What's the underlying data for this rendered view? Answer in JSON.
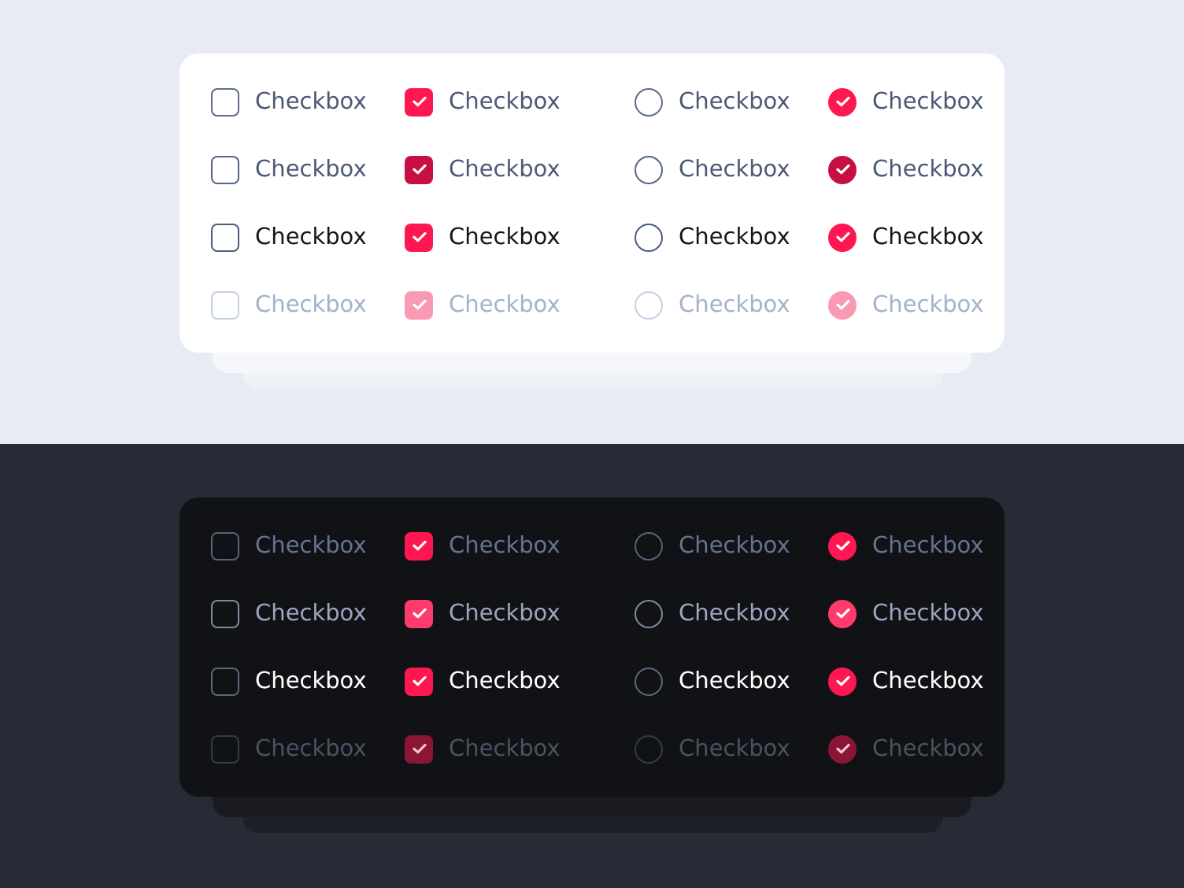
{
  "panels": [
    {
      "kind": "light",
      "rows": [
        {
          "kind": "default",
          "items": [
            {
              "kind": "square",
              "checked": false,
              "label": "Checkbox"
            },
            {
              "kind": "square",
              "checked": true,
              "label": "Checkbox"
            },
            {
              "kind": "round",
              "checked": false,
              "label": "Checkbox"
            },
            {
              "kind": "round",
              "checked": true,
              "label": "Checkbox"
            }
          ]
        },
        {
          "kind": "hover",
          "items": [
            {
              "kind": "square",
              "checked": false,
              "label": "Checkbox"
            },
            {
              "kind": "square",
              "checked": true,
              "label": "Checkbox"
            },
            {
              "kind": "round",
              "checked": false,
              "label": "Checkbox"
            },
            {
              "kind": "round",
              "checked": true,
              "label": "Checkbox"
            }
          ]
        },
        {
          "kind": "focus",
          "items": [
            {
              "kind": "square",
              "checked": false,
              "label": "Checkbox"
            },
            {
              "kind": "square",
              "checked": true,
              "label": "Checkbox"
            },
            {
              "kind": "round",
              "checked": false,
              "label": "Checkbox"
            },
            {
              "kind": "round",
              "checked": true,
              "label": "Checkbox"
            }
          ]
        },
        {
          "kind": "disabled",
          "items": [
            {
              "kind": "square",
              "checked": false,
              "label": "Checkbox"
            },
            {
              "kind": "square",
              "checked": true,
              "label": "Checkbox"
            },
            {
              "kind": "round",
              "checked": false,
              "label": "Checkbox"
            },
            {
              "kind": "round",
              "checked": true,
              "label": "Checkbox"
            }
          ]
        }
      ]
    },
    {
      "kind": "dark",
      "rows": [
        {
          "kind": "default",
          "items": [
            {
              "kind": "square",
              "checked": false,
              "label": "Checkbox"
            },
            {
              "kind": "square",
              "checked": true,
              "label": "Checkbox"
            },
            {
              "kind": "round",
              "checked": false,
              "label": "Checkbox"
            },
            {
              "kind": "round",
              "checked": true,
              "label": "Checkbox"
            }
          ]
        },
        {
          "kind": "hover",
          "items": [
            {
              "kind": "square",
              "checked": false,
              "label": "Checkbox"
            },
            {
              "kind": "square",
              "checked": true,
              "label": "Checkbox"
            },
            {
              "kind": "round",
              "checked": false,
              "label": "Checkbox"
            },
            {
              "kind": "round",
              "checked": true,
              "label": "Checkbox"
            }
          ]
        },
        {
          "kind": "focus",
          "items": [
            {
              "kind": "square",
              "checked": false,
              "label": "Checkbox"
            },
            {
              "kind": "square",
              "checked": true,
              "label": "Checkbox"
            },
            {
              "kind": "round",
              "checked": false,
              "label": "Checkbox"
            },
            {
              "kind": "round",
              "checked": true,
              "label": "Checkbox"
            }
          ]
        },
        {
          "kind": "disabled",
          "items": [
            {
              "kind": "square",
              "checked": false,
              "label": "Checkbox"
            },
            {
              "kind": "square",
              "checked": true,
              "label": "Checkbox"
            },
            {
              "kind": "round",
              "checked": false,
              "label": "Checkbox"
            },
            {
              "kind": "round",
              "checked": true,
              "label": "Checkbox"
            }
          ]
        }
      ]
    }
  ]
}
